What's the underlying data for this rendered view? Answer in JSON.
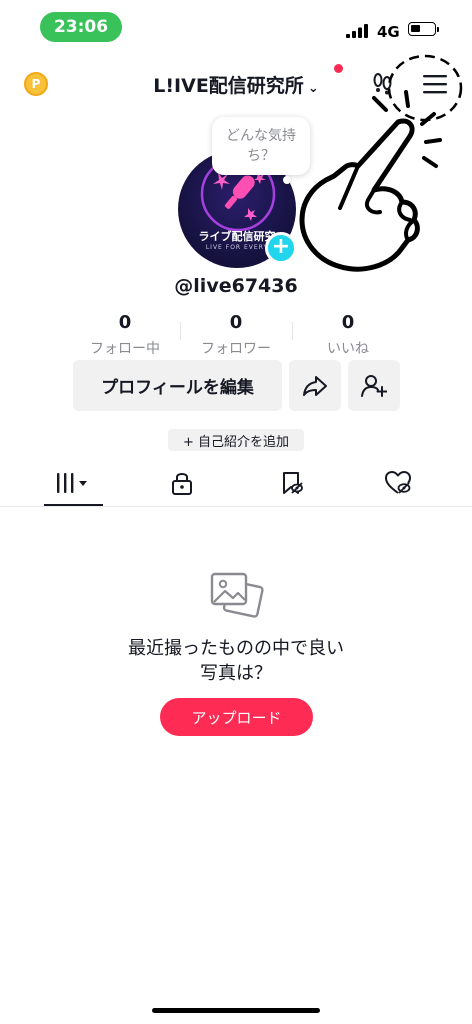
{
  "status_bar": {
    "time": "23:06",
    "network": "4G",
    "battery_level": 0.3
  },
  "header": {
    "title": "L!IVE配信研究所",
    "chevron": "⌄",
    "coin_symbol": "P",
    "icons": [
      "coin-icon",
      "footprint-icon",
      "menu-icon"
    ]
  },
  "profile": {
    "bubble_text": "どんな気持ち？",
    "avatar_caption": "ライブ配信研究",
    "avatar_subcaption": "LIVE FOR EVERY",
    "add_symbol": "+",
    "username": "@live67436"
  },
  "stats": [
    {
      "value": "0",
      "label": "フォロー中"
    },
    {
      "value": "0",
      "label": "フォロワー"
    },
    {
      "value": "0",
      "label": "いいね"
    }
  ],
  "actions": {
    "edit_profile": "プロフィールを編集",
    "add_bio": "+ 自己紹介を追加"
  },
  "tabs": [
    {
      "icon": "grid-icon",
      "active": true
    },
    {
      "icon": "lock-icon",
      "active": false
    },
    {
      "icon": "saved-icon",
      "active": false
    },
    {
      "icon": "liked-icon",
      "active": false
    }
  ],
  "empty_state": {
    "title_line1": "最近撮ったものの中で良い",
    "title_line2": "写真は？",
    "upload_label": "アップロード"
  },
  "colors": {
    "accent": "#fe2c55",
    "cyan": "#20d5ec",
    "time_pill": "#3ac25a"
  }
}
